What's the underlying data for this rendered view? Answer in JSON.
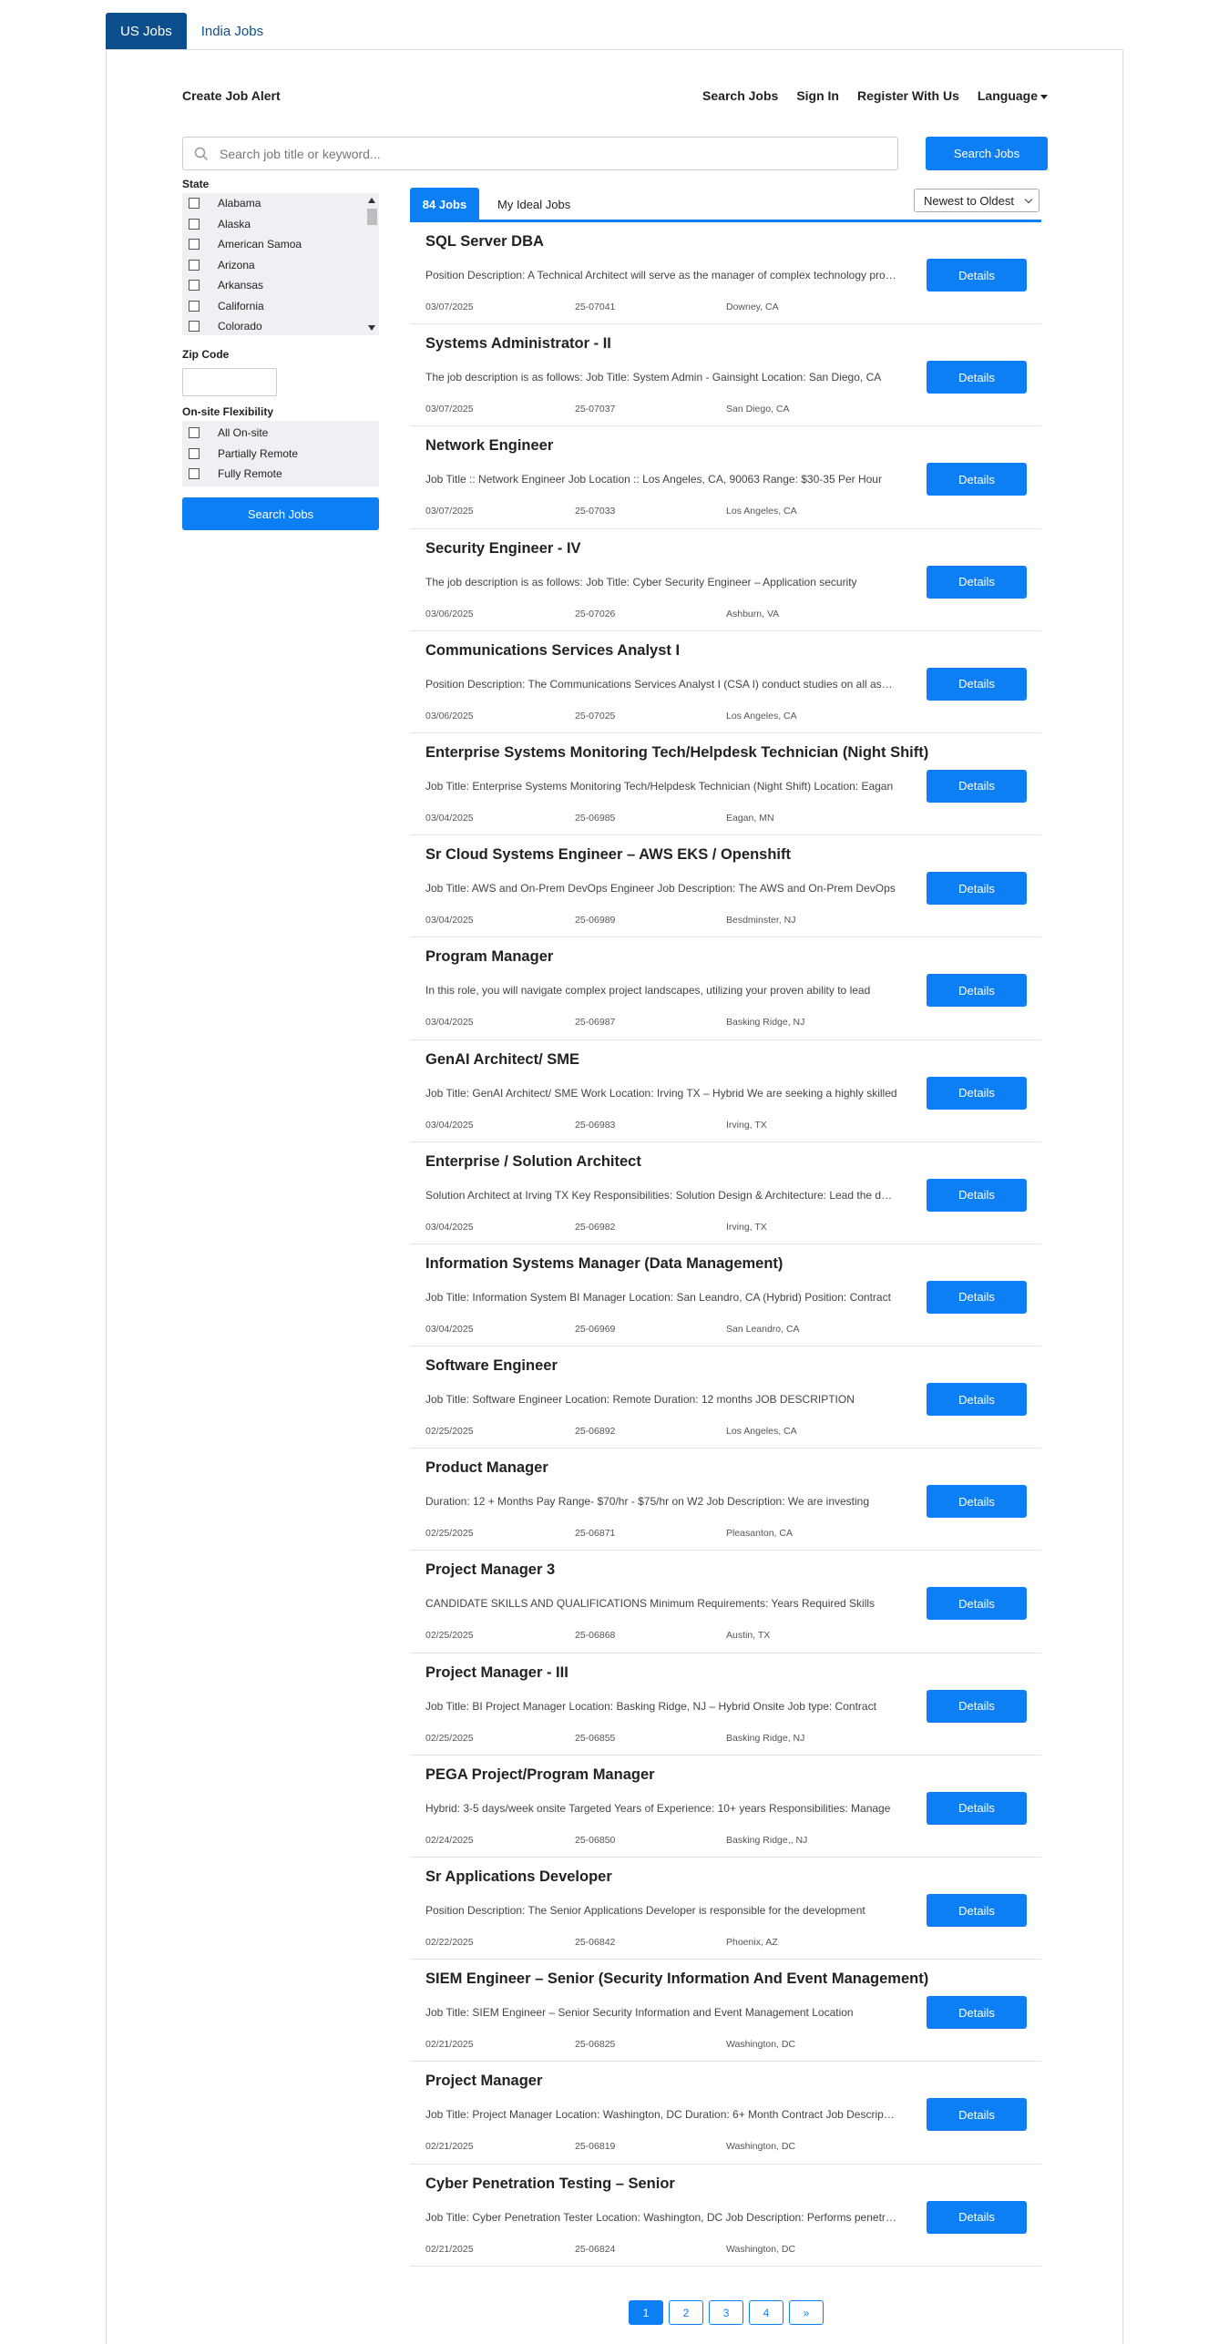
{
  "top_tabs": [
    {
      "label": "US Jobs",
      "active": true
    },
    {
      "label": "India Jobs",
      "active": false
    }
  ],
  "header": {
    "create_alert": "Create Job Alert",
    "links": [
      "Search Jobs",
      "Sign In",
      "Register With Us"
    ],
    "language": "Language"
  },
  "search": {
    "placeholder": "Search job title or keyword...",
    "value": "",
    "button": "Search Jobs"
  },
  "sidebar": {
    "state_label": "State",
    "states": [
      "Alabama",
      "Alaska",
      "American Samoa",
      "Arizona",
      "Arkansas",
      "California",
      "Colorado"
    ],
    "zip_label": "Zip Code",
    "zip_value": "",
    "flex_label": "On-site Flexibility",
    "flex_options": [
      "All On-site",
      "Partially Remote",
      "Fully Remote"
    ],
    "search_button": "Search Jobs"
  },
  "results": {
    "count_tab": "84 Jobs",
    "ideal_tab": "My Ideal Jobs",
    "sort": "Newest to Oldest",
    "details_label": "Details"
  },
  "jobs": [
    {
      "title": "SQL Server DBA",
      "desc": "Position Description: A Technical Architect will serve as the manager of complex technology projects",
      "date": "03/07/2025",
      "id": "25-07041",
      "location": "Downey, CA"
    },
    {
      "title": "Systems Administrator - II",
      "desc": "The job description is as follows:  Job Title: System Admin - Gainsight Location: San Diego, CA",
      "date": "03/07/2025",
      "id": "25-07037",
      "location": "San Diego, CA"
    },
    {
      "title": "Network Engineer",
      "desc": "Job Title :: Network Engineer Job Location :: Los Angeles, CA, 90063 Range: $30-35 Per Hour",
      "date": "03/07/2025",
      "id": "25-07033",
      "location": "Los Angeles, CA"
    },
    {
      "title": "Security Engineer - IV",
      "desc": "The job description is as follows:  Job Title: Cyber Security Engineer – Application security",
      "date": "03/06/2025",
      "id": "25-07026",
      "location": "Ashburn, VA"
    },
    {
      "title": "Communications Services Analyst I",
      "desc": "Position Description: The Communications Services Analyst I (CSA I) conduct studies on all aspects",
      "date": "03/06/2025",
      "id": "25-07025",
      "location": "Los Angeles, CA"
    },
    {
      "title": "Enterprise Systems Monitoring Tech/Helpdesk Technician (Night Shift)",
      "desc": "Job Title: Enterprise Systems Monitoring Tech/Helpdesk Technician (Night Shift) Location: Eagan",
      "date": "03/04/2025",
      "id": "25-06985",
      "location": "Eagan, MN"
    },
    {
      "title": "Sr Cloud Systems Engineer – AWS EKS / Openshift",
      "desc": "Job Title: AWS and On-Prem DevOps Engineer Job Description: The AWS and On-Prem DevOps",
      "date": "03/04/2025",
      "id": "25-06989",
      "location": "Besdminster, NJ"
    },
    {
      "title": "Program Manager",
      "desc": "In this role, you will navigate complex project landscapes, utilizing your proven ability to lead",
      "date": "03/04/2025",
      "id": "25-06987",
      "location": "Basking Ridge, NJ"
    },
    {
      "title": "GenAI Architect/ SME",
      "desc": "Job Title: GenAI Architect/ SME Work Location: Irving TX – Hybrid We are seeking a highly skilled",
      "date": "03/04/2025",
      "id": "25-06983",
      "location": "Irving, TX"
    },
    {
      "title": "Enterprise / Solution Architect",
      "desc": "Solution Architect at Irving TX Key Responsibilities: Solution Design & Architecture: Lead the design",
      "date": "03/04/2025",
      "id": "25-06982",
      "location": "Irving, TX"
    },
    {
      "title": "Information Systems Manager (Data Management)",
      "desc": "Job Title: Information System BI Manager Location: San Leandro, CA (Hybrid) Position: Contract",
      "date": "03/04/2025",
      "id": "25-06969",
      "location": "San Leandro, CA"
    },
    {
      "title": "Software Engineer",
      "desc": "Job Title: Software Engineer Location: Remote Duration: 12 months   JOB DESCRIPTION",
      "date": "02/25/2025",
      "id": "25-06892",
      "location": "Los Angeles, CA"
    },
    {
      "title": "Product Manager",
      "desc": "Duration: 12 + Months Pay Range- $70/hr - $75/hr on W2 Job Description: We are investing",
      "date": "02/25/2025",
      "id": "25-06871",
      "location": "Pleasanton, CA"
    },
    {
      "title": "Project Manager 3",
      "desc": "CANDIDATE SKILLS AND QUALIFICATIONS Minimum Requirements: Years Required Skills",
      "date": "02/25/2025",
      "id": "25-06868",
      "location": "Austin, TX"
    },
    {
      "title": "Project Manager - III",
      "desc": "Job Title: BI Project Manager Location: Basking Ridge, NJ – Hybrid Onsite Job type: Contract",
      "date": "02/25/2025",
      "id": "25-06855",
      "location": "Basking Ridge, NJ"
    },
    {
      "title": "PEGA Project/Program Manager",
      "desc": "Hybrid: 3-5 days/week onsite Targeted Years of Experience: 10+ years Responsibilities: Manage",
      "date": "02/24/2025",
      "id": "25-06850",
      "location": "Basking Ridge,, NJ"
    },
    {
      "title": "Sr Applications Developer",
      "desc": "Position Description: The Senior Applications Developer is responsible for the development",
      "date": "02/22/2025",
      "id": "25-06842",
      "location": "Phoenix, AZ"
    },
    {
      "title": "SIEM Engineer – Senior (Security Information And Event Management)",
      "desc": "Job Title: SIEM Engineer – Senior Security Information and Event Management Location",
      "date": "02/21/2025",
      "id": "25-06825",
      "location": "Washington, DC"
    },
    {
      "title": "Project Manager",
      "desc": "Job Title: Project Manager Location: Washington, DC Duration: 6+ Month Contract   Job Description",
      "date": "02/21/2025",
      "id": "25-06819",
      "location": "Washington, DC"
    },
    {
      "title": "Cyber Penetration Testing – Senior",
      "desc": "Job Title: Cyber Penetration Tester Location: Washington, DC Job Description: Performs penetration",
      "date": "02/21/2025",
      "id": "25-06824",
      "location": "Washington, DC"
    }
  ],
  "pagination": {
    "pages": [
      "1",
      "2",
      "3",
      "4"
    ],
    "current": "1",
    "next": "»"
  },
  "colors": {
    "tab_active": "#0d4f8c",
    "primary": "#0d7ff5",
    "filter_bg": "#eef0f3"
  }
}
